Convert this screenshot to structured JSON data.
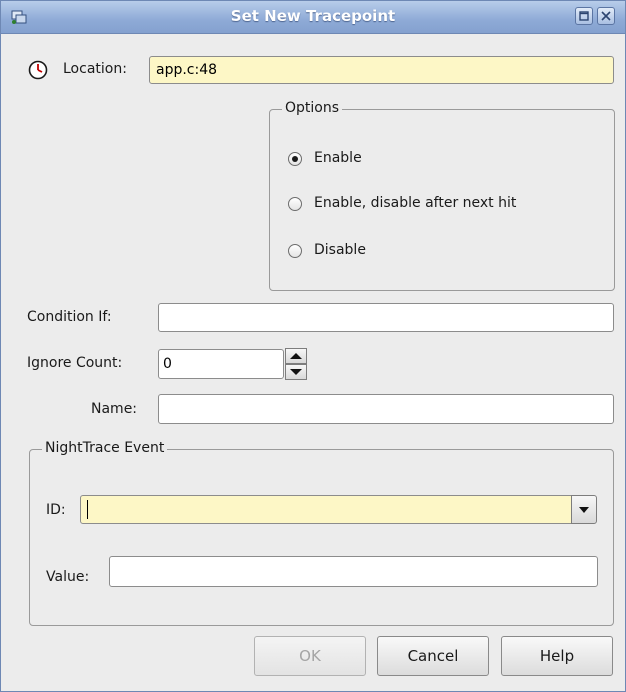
{
  "window": {
    "title": "Set New Tracepoint"
  },
  "location": {
    "label": "Location:",
    "value": "app.c:48"
  },
  "options": {
    "legend": "Options",
    "items": [
      {
        "label": "Enable",
        "checked": true
      },
      {
        "label": "Enable, disable after next hit",
        "checked": false
      },
      {
        "label": "Disable",
        "checked": false
      }
    ]
  },
  "condition": {
    "label": "Condition If:",
    "value": ""
  },
  "ignore_count": {
    "label": "Ignore Count:",
    "value": "0"
  },
  "name": {
    "label": "Name:",
    "value": ""
  },
  "nighttrace": {
    "legend": "NightTrace Event",
    "id_label": "ID:",
    "id_value": "",
    "value_label": "Value:",
    "value_value": ""
  },
  "buttons": {
    "ok": "OK",
    "cancel": "Cancel",
    "help": "Help"
  },
  "colors": {
    "titlebar": "#8eaad6",
    "field_highlight": "#fdf7c6",
    "dialog_bg": "#ececec"
  }
}
